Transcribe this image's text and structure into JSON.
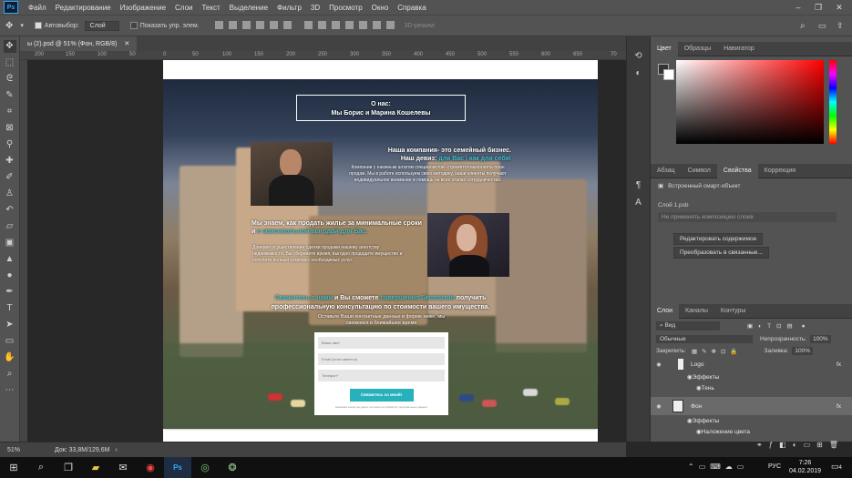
{
  "app": {
    "logo": "Ps",
    "menu": [
      "Файл",
      "Редактирование",
      "Изображение",
      "Слои",
      "Текст",
      "Выделение",
      "Фильтр",
      "3D",
      "Просмотр",
      "Окно",
      "Справка"
    ]
  },
  "options": {
    "autoselect_label": "Автовыбор:",
    "autoselect_value": "Слой",
    "show_controls": "Показать упр. элем.",
    "mode3d": "3D-режим:"
  },
  "document": {
    "tab_title": "ы (2).psd @ 51% (Фон, RGB/8)",
    "ruler_ticks": [
      "200",
      "150",
      "100",
      "50",
      "0",
      "50",
      "100",
      "150",
      "200",
      "250",
      "300",
      "350",
      "400",
      "450",
      "500",
      "550",
      "600",
      "650",
      "70"
    ]
  },
  "site": {
    "about_line1": "О нас:",
    "about_line2": "Мы Борис и Марина Кошелевы",
    "block1_h1": "Наша компания- это семейный бизнес.",
    "block1_h2a": "Наш девиз: ",
    "block1_h2b": "для Вас \\ как для себя!",
    "block1_body": "Компании с наемным штатом специалистов- стремятся выполнять план продаж. Мы в работе используем свою методику, наши клиенты получают индивидуальное внимание и помощь на всех этапах сотрудничества.",
    "block2_h1": "Мы знаем, как продать жилье за минимальные сроки и ",
    "block2_h1b": "с максимальной выгодой для Вас.",
    "block2_body": "Доверия осуществление сделки продажи нашему агентству недвижимости, Вы сбережете время, выгодно продадите имущество и получите полный комплекс необходимых услуг.",
    "cta_a": "Свяжитесь с нами",
    "cta_b": " и Вы сможете ",
    "cta_c": "совершенно бесплатно",
    "cta_d": " получить профессиональную консультацию по стоимости вашего имущества.",
    "cta_sub": "Оставьте Ваши контактные данные в форме ниже, мы свяжемся в ближайшее время",
    "form_name": "Ваше имя*",
    "form_email": "Email (если имеется)",
    "form_phone": "Телефон*",
    "form_button": "Свяжитесь со мной!",
    "form_fine": "Нажимая кнопку вы даёте согласие на обработку персональных данных"
  },
  "status": {
    "zoom": "51%",
    "docsize": "Док: 33,8M/129,6M"
  },
  "panels": {
    "color_tabs": [
      "Цвет",
      "Образцы",
      "Навигатор"
    ],
    "props_tabs": [
      "Абзац",
      "Символ",
      "Свойства",
      "Коррекция"
    ],
    "smart_object": "Встроенный смарт-объект",
    "linked_file": "Слой 1.psb",
    "comp_select": "Не применять композицию слоев",
    "edit_btn": "Редактировать содержимое",
    "convert_btn": "Преобразовать в связанные...",
    "layers_tabs": [
      "Слои",
      "Каналы",
      "Контуры"
    ],
    "kind": "Вид",
    "blend": "Обычные",
    "opacity_label": "Непрозрачность:",
    "opacity": "100%",
    "lock_label": "Закрепить:",
    "fill_label": "Заливка:",
    "fill": "100%",
    "layers": [
      {
        "name": "Logo",
        "sub": [
          "Эффекты",
          "Тень"
        ]
      },
      {
        "name": "Фон",
        "sub": [
          "Эффекты",
          "Наложение цвета"
        ]
      }
    ],
    "fx": "fx"
  },
  "taskbar": {
    "time": "7:26",
    "date": "04.02.2019",
    "lang": "РУС",
    "notif": "4"
  },
  "colors": {
    "accent": "#31a8ff",
    "cyan": "#43c4ce",
    "button": "#26b1bc",
    "panel": "#535353",
    "picker_hue": "#ff0000"
  }
}
